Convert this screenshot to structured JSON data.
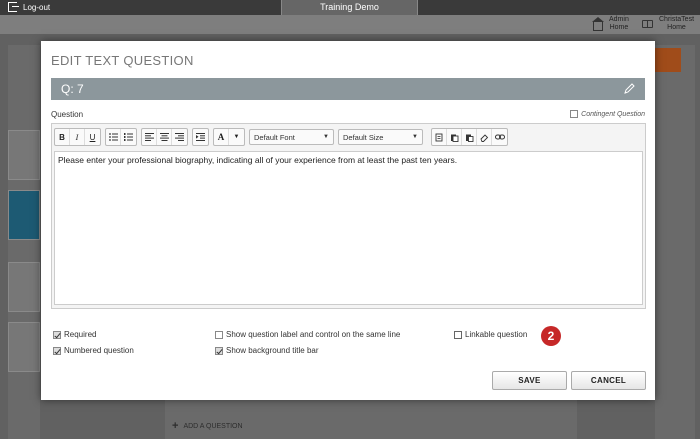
{
  "topbar": {
    "logout_label": "Log-out",
    "app_title": "Training Demo"
  },
  "subbar": {
    "admin_home_line1": "Admin",
    "admin_home_line2": "Home",
    "user_home_line1": "ChristaTest",
    "user_home_line2": "Home"
  },
  "background": {
    "add_question": "ADD A QUESTION"
  },
  "modal": {
    "title": "EDIT TEXT QUESTION",
    "question_number": "Q: 7",
    "question_label": "Question",
    "contingent_label": "Contingent Question",
    "contingent_checked": false,
    "toolbar": {
      "bold": "B",
      "italic": "I",
      "underline": "U",
      "font_color": "A",
      "font_select": "Default Font",
      "size_select": "Default Size"
    },
    "question_text": "Please enter your professional biography, indicating all of your experience from at least the past ten years.",
    "options": {
      "required": {
        "label": "Required",
        "checked": true
      },
      "numbered": {
        "label": "Numbered question",
        "checked": true
      },
      "same_line": {
        "label": "Show question label and control on the same line",
        "checked": false
      },
      "background_bar": {
        "label": "Show background title bar",
        "checked": true
      },
      "linkable": {
        "label": "Linkable question",
        "checked": false
      }
    },
    "step_badge": "2",
    "save_label": "SAVE",
    "cancel_label": "CANCEL"
  },
  "colors": {
    "question_bar": "#8c979c",
    "badge": "#c62828",
    "topbar": "#3a3a3a"
  },
  "icons": [
    "logout-icon",
    "house-icon",
    "book-icon",
    "pencil-icon",
    "bullet-list-icon",
    "numbered-list-icon",
    "align-left-icon",
    "align-center-icon",
    "align-right-icon",
    "indent-icon",
    "copy-icon",
    "paste-icon",
    "paste-text-icon",
    "eraser-icon",
    "link-icon"
  ]
}
